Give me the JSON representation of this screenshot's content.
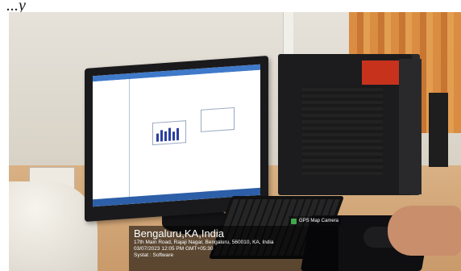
{
  "brand_text": "...y",
  "gps_camera": {
    "icon": "gps-map-camera-icon",
    "label": "GPS Map Camera"
  },
  "location": {
    "city": "Bengaluru,KA,India",
    "address": "17th Main Road, Rajaji Nagar, Bengaluru, 560010, KA, India",
    "datetime": "03/07/2023 12:05 PM GMT+05:30",
    "note": "Systat : Software"
  },
  "colors": {
    "desk": "#c99a6a",
    "wall": "#e6e2da",
    "curtain": "#d9893a",
    "screen_taskbar": "#2d5fa8"
  }
}
